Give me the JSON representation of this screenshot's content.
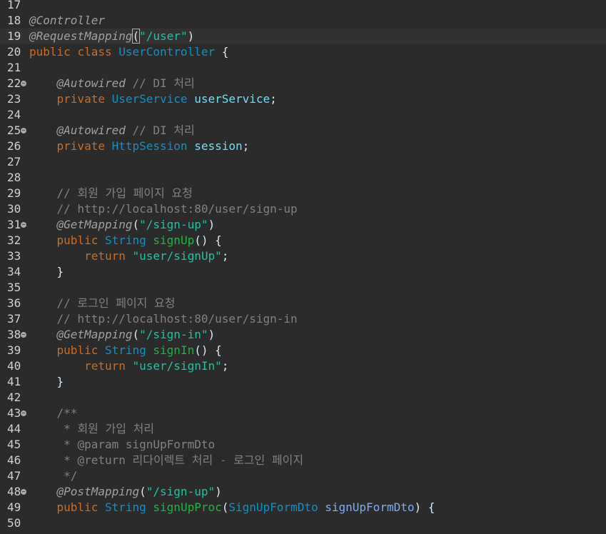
{
  "lines": [
    {
      "n": "17",
      "tokens": []
    },
    {
      "n": "18",
      "tokens": [
        {
          "t": "@Controller",
          "c": "ann"
        }
      ]
    },
    {
      "n": "19",
      "hl": true,
      "tokens": [
        {
          "t": "@RequestMapping",
          "c": "ann"
        },
        {
          "t": "(",
          "c": "plain bracket"
        },
        {
          "t": "\"/user\"",
          "c": "str"
        },
        {
          "t": ")",
          "c": "plain"
        }
      ]
    },
    {
      "n": "20",
      "tokens": [
        {
          "t": "public ",
          "c": "kw"
        },
        {
          "t": "class ",
          "c": "kw"
        },
        {
          "t": "UserController",
          "c": "type"
        },
        {
          "t": " {",
          "c": "plain"
        }
      ]
    },
    {
      "n": "21",
      "tokens": []
    },
    {
      "n": "22",
      "fold": true,
      "tokens": [
        {
          "t": "    "
        },
        {
          "t": "@Autowired",
          "c": "ann"
        },
        {
          "t": " // DI 처리",
          "c": "cmt"
        }
      ]
    },
    {
      "n": "23",
      "tokens": [
        {
          "t": "    "
        },
        {
          "t": "private ",
          "c": "kw"
        },
        {
          "t": "UserService",
          "c": "type"
        },
        {
          "t": " "
        },
        {
          "t": "userService",
          "c": "field"
        },
        {
          "t": ";",
          "c": "plain"
        }
      ]
    },
    {
      "n": "24",
      "tokens": []
    },
    {
      "n": "25",
      "fold": true,
      "tokens": [
        {
          "t": "    "
        },
        {
          "t": "@Autowired",
          "c": "ann"
        },
        {
          "t": " // DI 처리",
          "c": "cmt"
        }
      ]
    },
    {
      "n": "26",
      "tokens": [
        {
          "t": "    "
        },
        {
          "t": "private ",
          "c": "kw"
        },
        {
          "t": "HttpSession",
          "c": "type"
        },
        {
          "t": " "
        },
        {
          "t": "session",
          "c": "field"
        },
        {
          "t": ";",
          "c": "plain"
        }
      ]
    },
    {
      "n": "27",
      "tokens": []
    },
    {
      "n": "28",
      "tokens": []
    },
    {
      "n": "29",
      "tokens": [
        {
          "t": "    "
        },
        {
          "t": "// 회원 가입 페이지 요청",
          "c": "cmt"
        }
      ]
    },
    {
      "n": "30",
      "tokens": [
        {
          "t": "    "
        },
        {
          "t": "// http://localhost:80/user/sign-up",
          "c": "cmt"
        }
      ]
    },
    {
      "n": "31",
      "fold": true,
      "tokens": [
        {
          "t": "    "
        },
        {
          "t": "@GetMapping",
          "c": "ann"
        },
        {
          "t": "(",
          "c": "plain"
        },
        {
          "t": "\"/sign-up\"",
          "c": "str"
        },
        {
          "t": ")",
          "c": "plain"
        }
      ]
    },
    {
      "n": "32",
      "tokens": [
        {
          "t": "    "
        },
        {
          "t": "public ",
          "c": "kw"
        },
        {
          "t": "String",
          "c": "type"
        },
        {
          "t": " "
        },
        {
          "t": "signUp",
          "c": "method"
        },
        {
          "t": "() {",
          "c": "plain"
        }
      ]
    },
    {
      "n": "33",
      "tokens": [
        {
          "t": "        "
        },
        {
          "t": "return ",
          "c": "kw"
        },
        {
          "t": "\"user/signUp\"",
          "c": "str"
        },
        {
          "t": ";",
          "c": "plain"
        }
      ]
    },
    {
      "n": "34",
      "tokens": [
        {
          "t": "    "
        },
        {
          "t": "}",
          "c": "plain"
        }
      ]
    },
    {
      "n": "35",
      "tokens": []
    },
    {
      "n": "36",
      "tokens": [
        {
          "t": "    "
        },
        {
          "t": "// 로그인 페이지 요청",
          "c": "cmt"
        }
      ]
    },
    {
      "n": "37",
      "tokens": [
        {
          "t": "    "
        },
        {
          "t": "// http://localhost:80/user/sign-in",
          "c": "cmt"
        }
      ]
    },
    {
      "n": "38",
      "fold": true,
      "tokens": [
        {
          "t": "    "
        },
        {
          "t": "@GetMapping",
          "c": "ann"
        },
        {
          "t": "(",
          "c": "plain"
        },
        {
          "t": "\"/sign-in\"",
          "c": "str"
        },
        {
          "t": ")",
          "c": "plain"
        }
      ]
    },
    {
      "n": "39",
      "tokens": [
        {
          "t": "    "
        },
        {
          "t": "public ",
          "c": "kw"
        },
        {
          "t": "String",
          "c": "type"
        },
        {
          "t": " "
        },
        {
          "t": "signIn",
          "c": "method"
        },
        {
          "t": "() {",
          "c": "plain"
        }
      ]
    },
    {
      "n": "40",
      "tokens": [
        {
          "t": "        "
        },
        {
          "t": "return ",
          "c": "kw"
        },
        {
          "t": "\"user/signIn\"",
          "c": "str"
        },
        {
          "t": ";",
          "c": "plain"
        }
      ]
    },
    {
      "n": "41",
      "tokens": [
        {
          "t": "    "
        },
        {
          "t": "}",
          "c": "plain"
        }
      ]
    },
    {
      "n": "42",
      "tokens": []
    },
    {
      "n": "43",
      "fold": true,
      "tokens": [
        {
          "t": "    "
        },
        {
          "t": "/**",
          "c": "cmt"
        }
      ]
    },
    {
      "n": "44",
      "tokens": [
        {
          "t": "     "
        },
        {
          "t": "* 회원 가입 처리",
          "c": "cmt"
        }
      ]
    },
    {
      "n": "45",
      "tokens": [
        {
          "t": "     "
        },
        {
          "t": "* @param signUpFormDto",
          "c": "cmt"
        }
      ]
    },
    {
      "n": "46",
      "tokens": [
        {
          "t": "     "
        },
        {
          "t": "* @return 리다이렉트 처리 ",
          "c": "cmt"
        },
        {
          "t": "-",
          "c": "cmt-dash"
        },
        {
          "t": " 로그인 페이지",
          "c": "cmt"
        }
      ]
    },
    {
      "n": "47",
      "tokens": [
        {
          "t": "     "
        },
        {
          "t": "*/",
          "c": "cmt"
        }
      ]
    },
    {
      "n": "48",
      "fold": true,
      "tokens": [
        {
          "t": "    "
        },
        {
          "t": "@PostMapping",
          "c": "ann"
        },
        {
          "t": "(",
          "c": "plain"
        },
        {
          "t": "\"/sign-up\"",
          "c": "str"
        },
        {
          "t": ")",
          "c": "plain"
        }
      ]
    },
    {
      "n": "49",
      "tokens": [
        {
          "t": "    "
        },
        {
          "t": "public ",
          "c": "kw"
        },
        {
          "t": "String",
          "c": "type"
        },
        {
          "t": " "
        },
        {
          "t": "signUpProc",
          "c": "method"
        },
        {
          "t": "(",
          "c": "plain"
        },
        {
          "t": "SignUpFormDto",
          "c": "type"
        },
        {
          "t": " "
        },
        {
          "t": "signUpFormDto",
          "c": "param"
        },
        {
          "t": ") {",
          "c": "plain"
        }
      ]
    },
    {
      "n": "50",
      "tokens": []
    }
  ],
  "fold_icon": "minus-circle-icon",
  "colors": {
    "background": "#2b2b2b",
    "line_highlight": "#323232",
    "keyword": "#cc6c1d",
    "type": "#1290c3",
    "string": "#17c6a3",
    "comment": "#808080",
    "annotation": "#a0a0a0"
  }
}
